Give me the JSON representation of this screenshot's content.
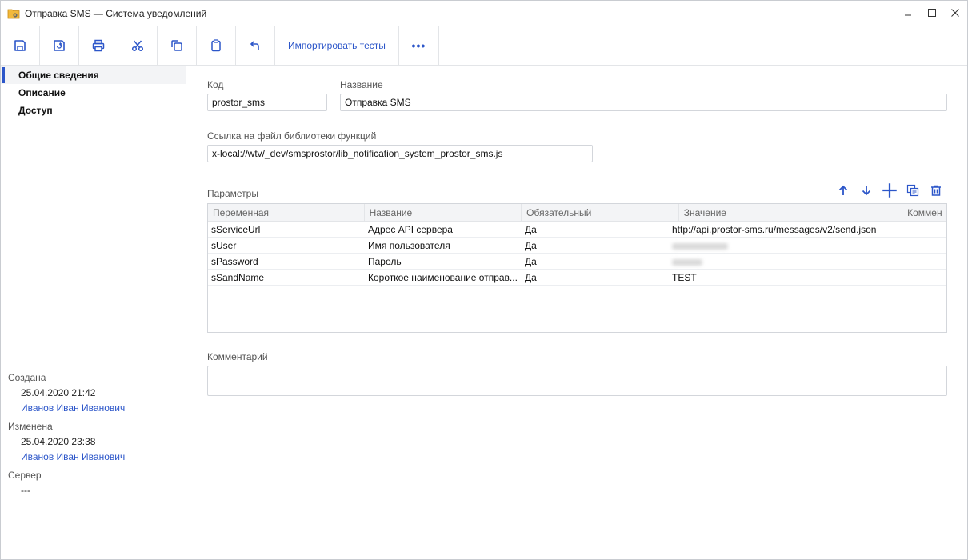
{
  "window": {
    "title": "Отправка SMS — Система уведомлений",
    "app_icon": "folder-gear-icon",
    "controls": [
      "minimize-icon",
      "maximize-icon",
      "close-icon"
    ]
  },
  "toolbar": {
    "icons": [
      "save-icon",
      "save-as-icon",
      "print-icon",
      "cut-icon",
      "copy-icon",
      "clipboard-icon",
      "undo-icon"
    ],
    "import_label": "Импортировать тесты",
    "more_label": "•••"
  },
  "sidebar": {
    "items": [
      {
        "label": "Общие сведения",
        "active": true
      },
      {
        "label": "Описание",
        "active": false
      },
      {
        "label": "Доступ",
        "active": false
      }
    ],
    "meta": {
      "created_label": "Создана",
      "created_date": "25.04.2020 21:42",
      "created_by": "Иванов Иван Иванович",
      "modified_label": "Изменена",
      "modified_date": "25.04.2020 23:38",
      "modified_by": "Иванов Иван Иванович",
      "server_label": "Сервер",
      "server_value": "---"
    }
  },
  "form": {
    "code_label": "Код",
    "code_value": "prostor_sms",
    "name_label": "Название",
    "name_value": "Отправка SMS",
    "lib_label": "Ссылка на файл библиотеки функций",
    "lib_value": "x-local://wtv/_dev/smsprostor/lib_notification_system_prostor_sms.js",
    "params_label": "Параметры",
    "comment_label": "Комментарий",
    "comment_value": ""
  },
  "params": {
    "tools": [
      "arrow-up-icon",
      "arrow-down-icon",
      "add-icon",
      "copy-row-icon",
      "delete-icon"
    ],
    "columns": [
      "Переменная",
      "Название",
      "Обязательный",
      "Значение",
      "Коммен"
    ],
    "rows": [
      {
        "var": "sServiceUrl",
        "name": "Адрес API сервера",
        "required": "Да",
        "value": "http://api.prostor-sms.ru/messages/v2/send.json",
        "hidden": false
      },
      {
        "var": "sUser",
        "name": "Имя пользователя",
        "required": "Да",
        "value": "",
        "hidden": true
      },
      {
        "var": "sPassword",
        "name": "Пароль",
        "required": "Да",
        "value": "",
        "hidden": true
      },
      {
        "var": "sSandName",
        "name": "Короткое наименование отправ...",
        "required": "Да",
        "value": "TEST",
        "hidden": false
      }
    ]
  }
}
